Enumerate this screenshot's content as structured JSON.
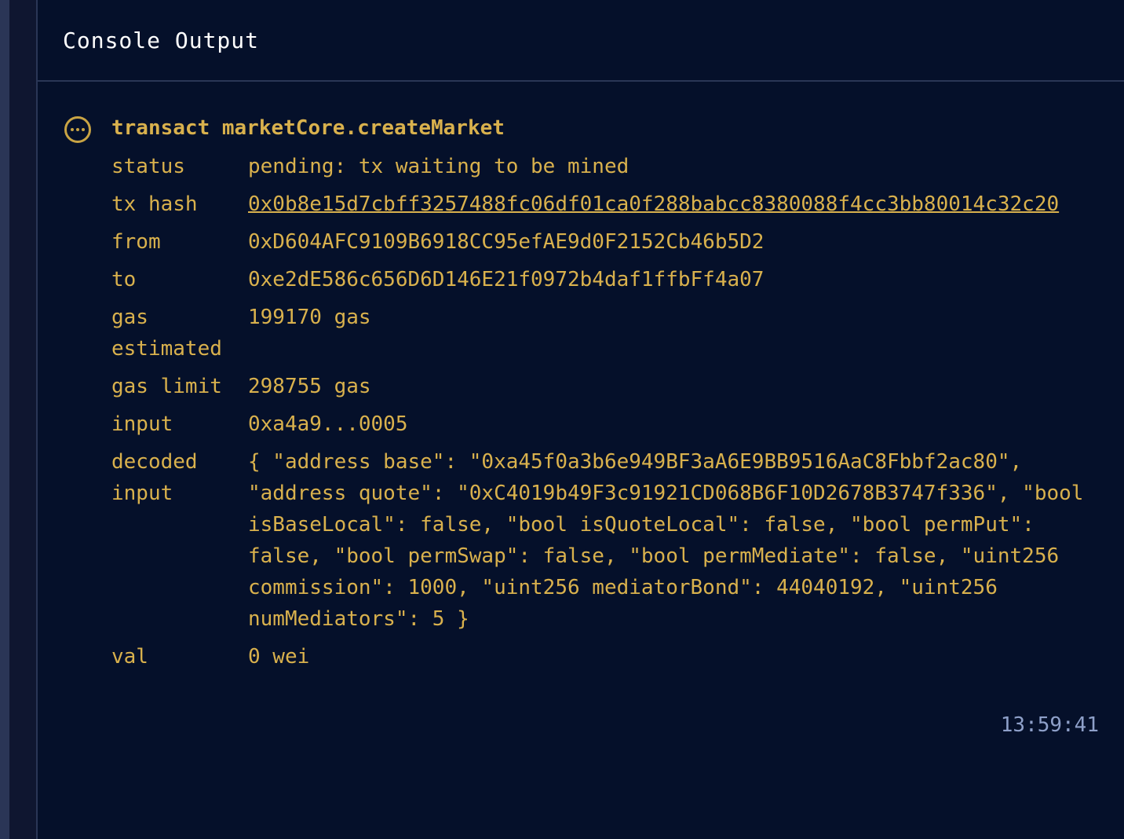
{
  "panel": {
    "title": "Console Output"
  },
  "entry": {
    "icon": "more-dots-icon",
    "title": "transact marketCore.createMarket",
    "rows": [
      {
        "key": "status",
        "value": "pending: tx waiting to be mined"
      },
      {
        "key": "tx hash",
        "value": "0x0b8e15d7cbff3257488fc06df01ca0f288babcc8380088f4cc3bb80014c32c20"
      },
      {
        "key": "from",
        "value": "0xD604AFC9109B6918CC95efAE9d0F2152Cb46b5D2"
      },
      {
        "key": "to",
        "value": "0xe2dE586c656D6D146E21f0972b4daf1ffbFf4a07"
      },
      {
        "key": "gas estimated",
        "value": "199170 gas"
      },
      {
        "key": "gas limit",
        "value": "298755 gas"
      },
      {
        "key": "input",
        "value": "0xa4a9...0005"
      },
      {
        "key": "decoded input",
        "value": "{ \"address base\": \"0xa45f0a3b6e949BF3aA6E9BB9516AaC8Fbbf2ac80\", \"address quote\": \"0xC4019b49F3c91921CD068B6F10D2678B3747f336\", \"bool isBaseLocal\": false, \"bool isQuoteLocal\": false, \"bool permPut\": false, \"bool permSwap\": false, \"bool permMediate\": false, \"uint256 commission\": 1000, \"uint256 mediatorBond\": 44040192, \"uint256 numMediators\": 5 }"
      },
      {
        "key": "val",
        "value": "0 wei"
      }
    ],
    "timestamp": "13:59:41"
  },
  "colors": {
    "background": "#05102a",
    "accent": "#d9b14d",
    "timestamp": "#8ea0c9",
    "title": "#ffffff"
  }
}
